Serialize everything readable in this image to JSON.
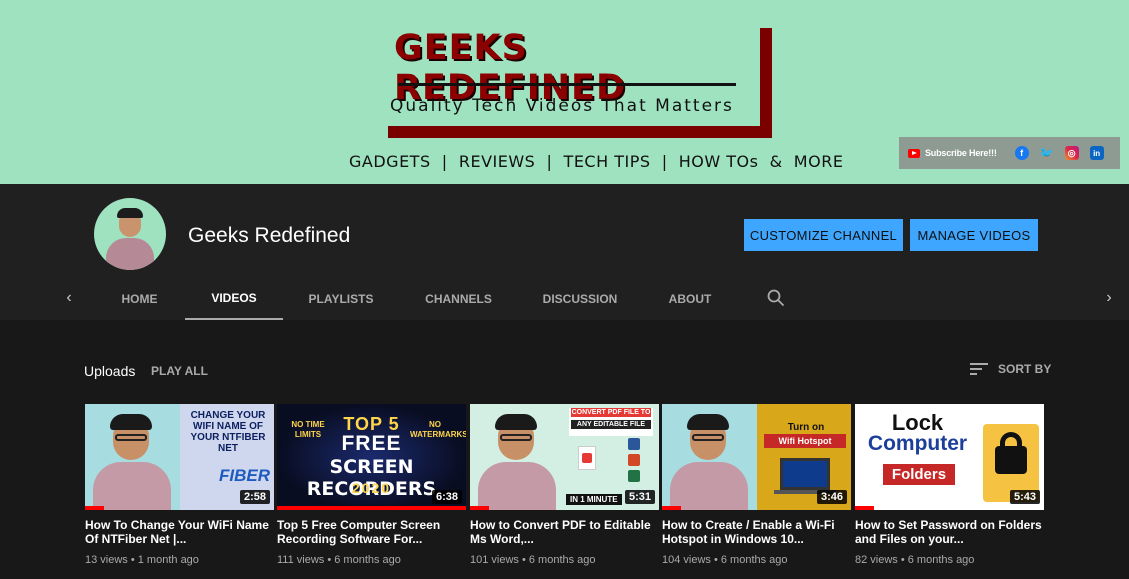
{
  "banner": {
    "title": "GEEKS REDEFINED",
    "tagline": "Quality Tech Videos That Matters",
    "categories": "GADGETS  |  REVIEWS  |  TECH TIPS  |  HOW TOs  &  MORE",
    "subscribe_text": "Subscribe Here!!!",
    "social": {
      "facebook": "f",
      "twitter": "🐦",
      "instagram": "◎",
      "linkedin": "in"
    }
  },
  "channel": {
    "name": "Geeks Redefined",
    "customize_label": "CUSTOMIZE CHANNEL",
    "manage_label": "MANAGE VIDEOS"
  },
  "tabs": {
    "prev_arrow": "‹",
    "next_arrow": "›",
    "items": [
      {
        "label": "HOME"
      },
      {
        "label": "VIDEOS"
      },
      {
        "label": "PLAYLISTS"
      },
      {
        "label": "CHANNELS"
      },
      {
        "label": "DISCUSSION"
      },
      {
        "label": "ABOUT"
      }
    ],
    "active": "VIDEOS"
  },
  "uploads": {
    "title": "Uploads",
    "play_all": "PLAY ALL",
    "sort_label": "SORT BY"
  },
  "videos": [
    {
      "title": "How To Change Your WiFi Name Of NTFiber Net |...",
      "meta": "13 views • 1 month ago",
      "duration": "2:58",
      "progress": 0.1,
      "thumb_text": "CHANGE YOUR WIFI NAME OF YOUR NTFIBER NET",
      "thumb_brand": "FIBER"
    },
    {
      "title": "Top 5 Free Computer Screen Recording Software For...",
      "meta": "111 views • 6 months ago",
      "duration": "6:38",
      "progress": 1.0,
      "thumb_top": "TOP 5",
      "thumb_free": "FREE",
      "thumb_main": "SCREEN RECORDERS",
      "thumb_year": "2020",
      "thumb_left": "NO TIME LIMITS",
      "thumb_right": "NO WATERMARKS"
    },
    {
      "title": "How to Convert PDF to Editable Ms Word,...",
      "meta": "101 views • 6 months ago",
      "duration": "5:31",
      "progress": 0.1,
      "thumb_head": "CONVERT PDF FILE TO",
      "thumb_sub": "ANY EDITABLE FILE",
      "thumb_min": "IN 1 MINUTE"
    },
    {
      "title": "How to Create / Enable a Wi-Fi Hotspot in Windows 10...",
      "meta": "104 views • 6 months ago",
      "duration": "3:46",
      "progress": 0.1,
      "thumb_text": "Turn on",
      "thumb_badge": "Wifi Hotspot"
    },
    {
      "title": "How to Set Password on Folders and Files on your...",
      "meta": "82 views • 6 months ago",
      "duration": "5:43",
      "progress": 0.1,
      "thumb_lock": "Lock",
      "thumb_comp": "Computer",
      "thumb_fold": "Folders"
    }
  ],
  "colors": {
    "banner_bg": "#9fe2c0",
    "accent_blue": "#3ea6ff",
    "progress_red": "#ff0000",
    "page_bg": "#181818"
  }
}
